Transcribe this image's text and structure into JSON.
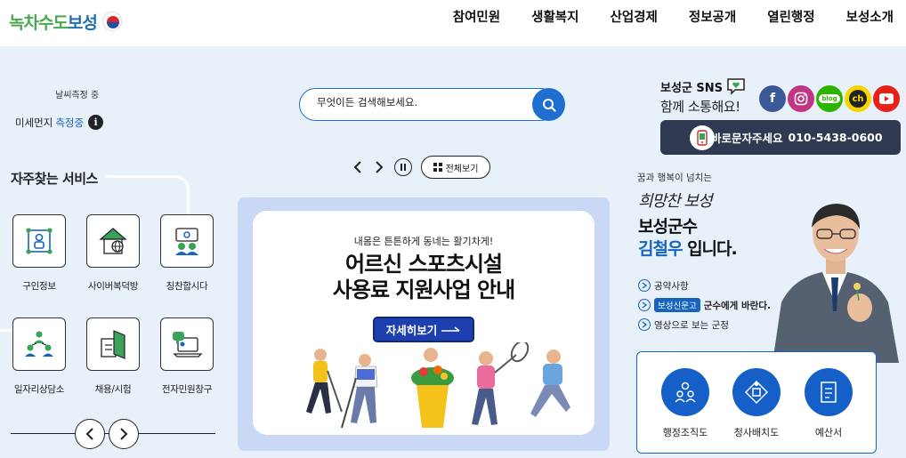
{
  "header": {
    "logo_text_1": "녹차수도",
    "logo_text_2": "보성",
    "nav": [
      "참여민원",
      "생활복지",
      "산업경제",
      "정보공개",
      "열린행정",
      "보성소개"
    ]
  },
  "weather": {
    "status": "날씨측정 중",
    "dust_label": "미세먼지",
    "dust_value": "측정중"
  },
  "search": {
    "placeholder": "무엇이든 검색해보세요."
  },
  "slider": {
    "view_all": "전체보기"
  },
  "banner": {
    "subtitle": "내몸은 튼튼하게 동네는 활기차게!",
    "title_line1": "어르신 스포츠시설",
    "title_line2": "사용료 지원사업 안내",
    "button": "자세히보기"
  },
  "services": {
    "title": "자주찾는 서비스",
    "items": [
      {
        "label": "구인정보",
        "icon": "job-board-icon"
      },
      {
        "label": "사이버복덕방",
        "icon": "house-globe-icon"
      },
      {
        "label": "칭찬합시다",
        "icon": "praise-board-icon"
      },
      {
        "label": "일자리상담소",
        "icon": "people-network-icon"
      },
      {
        "label": "채용/시험",
        "icon": "document-flag-icon"
      },
      {
        "label": "전자민원창구",
        "icon": "laptop-chat-icon"
      }
    ]
  },
  "sns": {
    "title": "보성군 SNS",
    "subtitle": "함께 소통해요!",
    "icons": [
      {
        "name": "facebook-icon",
        "glyph": "f",
        "color": "#3b5998"
      },
      {
        "name": "instagram-icon",
        "glyph": "◎",
        "color": "#c13584"
      },
      {
        "name": "blog-icon",
        "glyph": "blog",
        "color": "#2db400"
      },
      {
        "name": "kakao-channel-icon",
        "glyph": "ch",
        "color": "#f7d600"
      },
      {
        "name": "youtube-icon",
        "glyph": "▶",
        "color": "#e62117"
      }
    ]
  },
  "call": {
    "label": "보성바로문자주세요",
    "phone": "010-5438-0600"
  },
  "governor": {
    "sub": "꿈과 행복이 넘치는",
    "hope": "희망찬 보성",
    "line1": "보성군수",
    "name": "김철우",
    "line2_suffix": " 입니다.",
    "links": [
      {
        "text": "공약사항"
      },
      {
        "tag": "보성신문고",
        "text": "군수에게 바란다."
      },
      {
        "text": "영상으로 보는 군정"
      }
    ]
  },
  "quick": [
    {
      "label": "행정조직도",
      "icon": "org-chart-icon"
    },
    {
      "label": "청사배치도",
      "icon": "floor-plan-icon"
    },
    {
      "label": "예산서",
      "icon": "budget-doc-icon"
    }
  ]
}
